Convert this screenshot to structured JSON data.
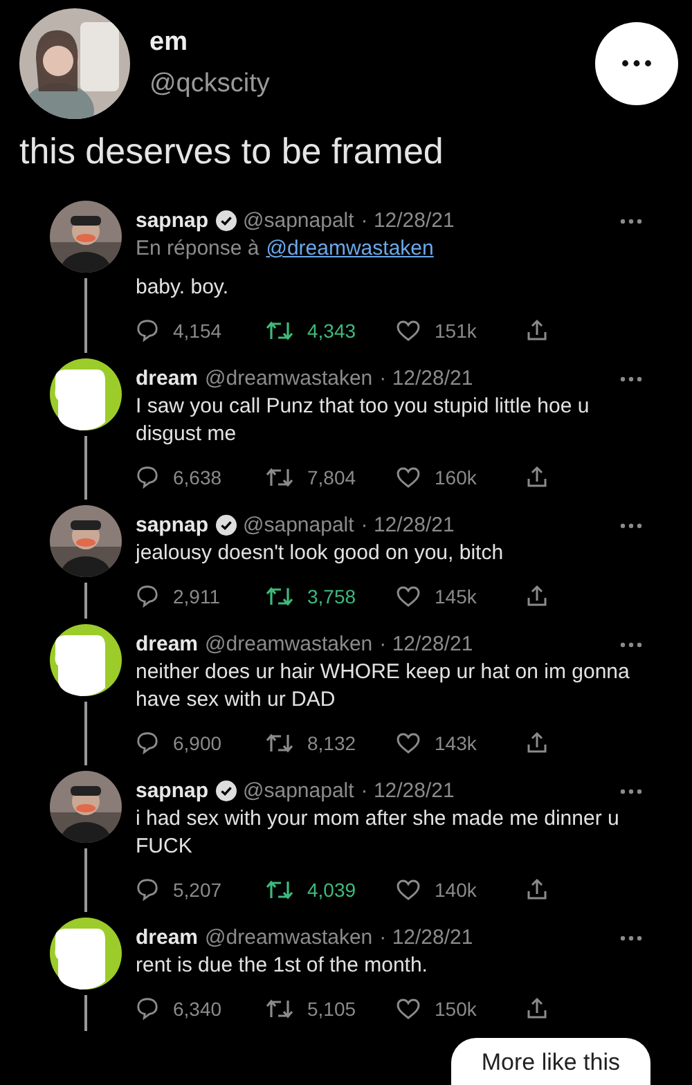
{
  "post": {
    "author": {
      "name": "em",
      "handle": "@qckscity"
    },
    "text": "this deserves to be framed"
  },
  "thread": [
    {
      "kind": "person",
      "name": "sapnap",
      "verified": true,
      "handle": "@sapnapalt",
      "date": "· 12/28/21",
      "reply_prefix": "En réponse à",
      "reply_to": "@dreamwastaken",
      "text": "baby. boy.",
      "replies": "4,154",
      "retweets": "4,343",
      "retweeted": true,
      "likes": "151k"
    },
    {
      "kind": "logo",
      "name": "dream",
      "verified": false,
      "handle": "@dreamwastaken",
      "date": "· 12/28/21",
      "text": "I saw you call Punz that too you stupid little hoe u disgust me",
      "replies": "6,638",
      "retweets": "7,804",
      "retweeted": false,
      "likes": "160k"
    },
    {
      "kind": "person",
      "name": "sapnap",
      "verified": true,
      "handle": "@sapnapalt",
      "date": "· 12/28/21",
      "text": "jealousy doesn't look good on you, bitch",
      "replies": "2,911",
      "retweets": "3,758",
      "retweeted": true,
      "likes": "145k"
    },
    {
      "kind": "logo",
      "name": "dream",
      "verified": false,
      "handle": "@dreamwastaken",
      "date": "· 12/28/21",
      "text": "neither does ur hair WHORE keep ur hat on im gonna have sex with ur DAD",
      "replies": "6,900",
      "retweets": "8,132",
      "retweeted": false,
      "likes": "143k"
    },
    {
      "kind": "person",
      "name": "sapnap",
      "verified": true,
      "handle": "@sapnapalt",
      "date": "· 12/28/21",
      "text": "i had sex with your mom after she made me dinner u FUCK",
      "replies": "5,207",
      "retweets": "4,039",
      "retweeted": true,
      "likes": "140k"
    },
    {
      "kind": "logo",
      "name": "dream",
      "verified": false,
      "handle": "@dreamwastaken",
      "date": "· 12/28/21",
      "text": "rent is due the 1st of the month.",
      "replies": "6,340",
      "retweets": "5,105",
      "retweeted": false,
      "likes": "150k"
    }
  ],
  "more_button": {
    "label": "More like this"
  }
}
